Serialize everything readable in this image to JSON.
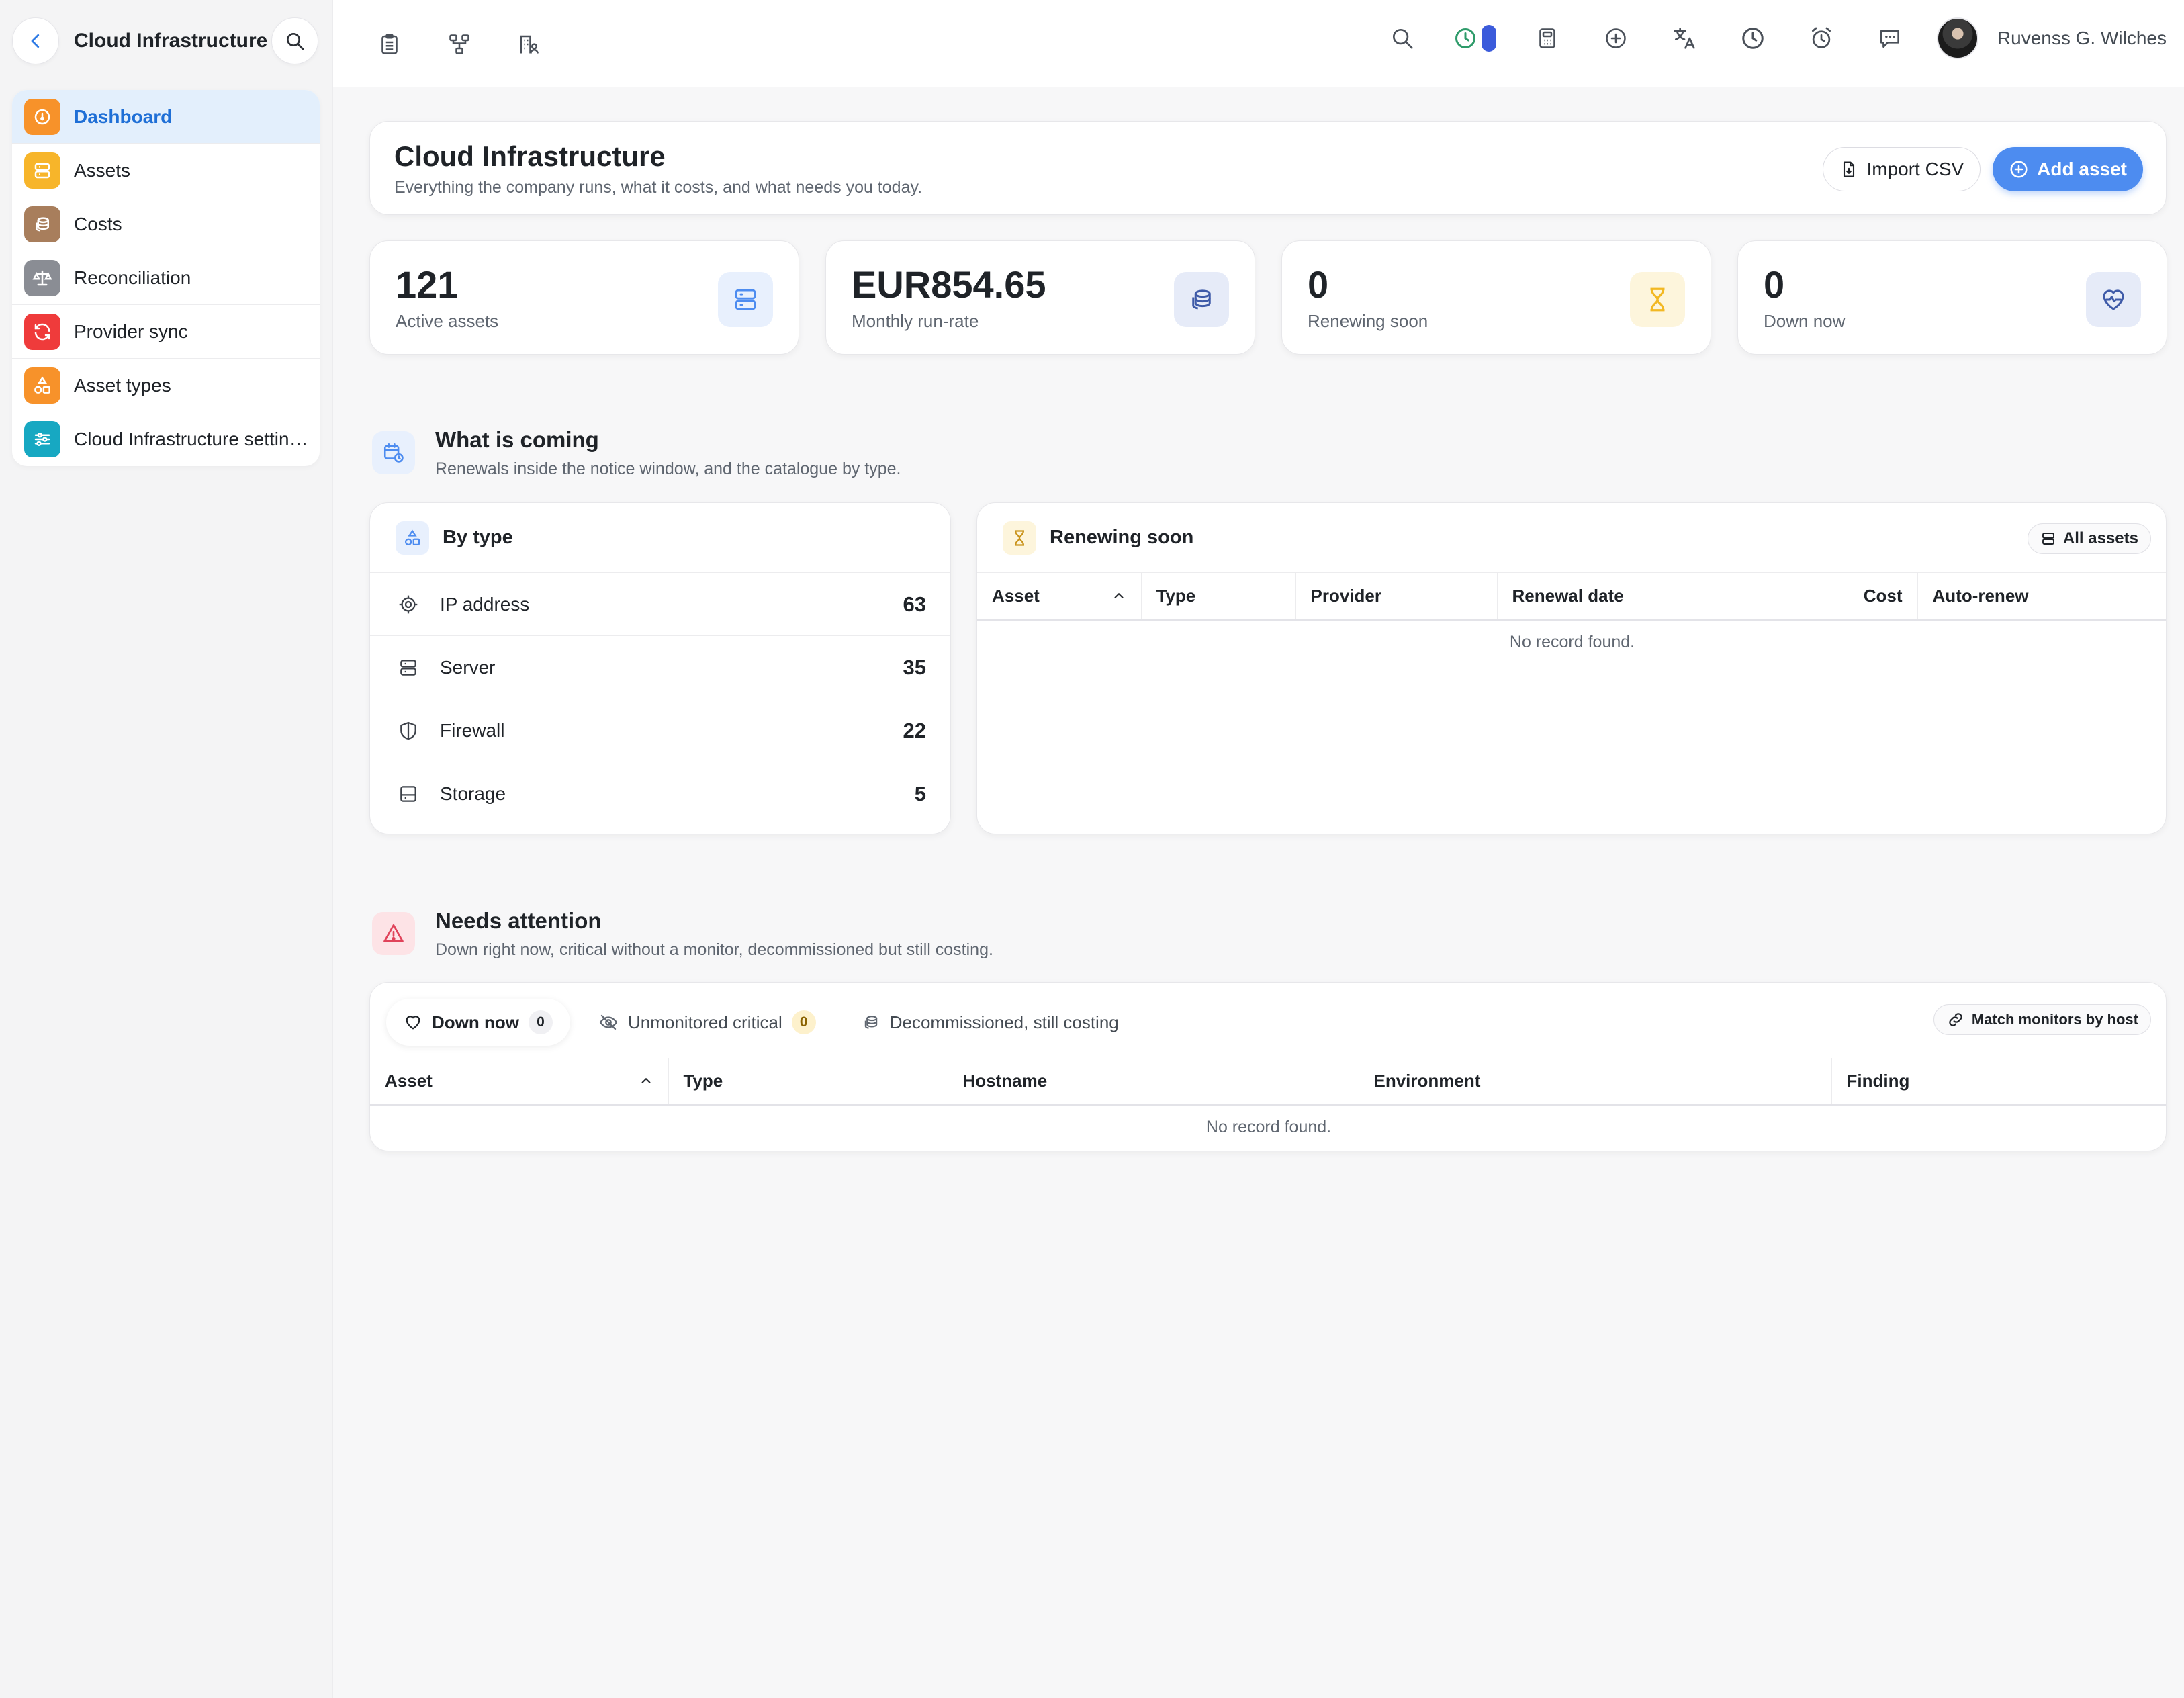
{
  "sidebar": {
    "title": "Cloud Infrastructure",
    "back_icon": "chevron-left-icon",
    "search_icon": "search-icon",
    "items": [
      {
        "label": "Dashboard",
        "icon": "dashboard-gauge-icon",
        "color": "#f7922a",
        "active": true
      },
      {
        "label": "Assets",
        "icon": "server-icon",
        "color": "#f7b52a"
      },
      {
        "label": "Costs",
        "icon": "coins-icon",
        "color": "#a87e5c"
      },
      {
        "label": "Reconciliation",
        "icon": "scale-icon",
        "color": "#8a8d94"
      },
      {
        "label": "Provider sync",
        "icon": "refresh-icon",
        "color": "#ef3b3b"
      },
      {
        "label": "Asset types",
        "icon": "shapes-icon",
        "color": "#f7922a"
      },
      {
        "label": "Cloud Infrastructure settings",
        "icon": "sliders-icon",
        "color": "#17a8c2"
      }
    ]
  },
  "topbar": {
    "left_icons": [
      "clipboard-icon",
      "hierarchy-icon",
      "building-users-icon"
    ],
    "right_icons": [
      "search-icon",
      "timer-icon",
      "calculator-icon",
      "plus-circle-icon",
      "translate-icon",
      "clock-icon",
      "alarm-icon",
      "chat-icon"
    ],
    "user_name": "Ruvenss G. Wilches"
  },
  "page": {
    "title": "Cloud Infrastructure",
    "subtitle": "Everything the company runs, what it costs, and what needs you today.",
    "import_label": "Import CSV",
    "add_label": "Add asset"
  },
  "stats": [
    {
      "value": "121",
      "label": "Active assets",
      "icon": "server-icon",
      "tint": "#e8f0fd",
      "color": "#4d8cf0"
    },
    {
      "value": "EUR854.65",
      "label": "Monthly run-rate",
      "icon": "coins-icon",
      "tint": "#e6ebf8",
      "color": "#3e5aa8"
    },
    {
      "value": "0",
      "label": "Renewing soon",
      "icon": "hourglass-icon",
      "tint": "#fdf5dc",
      "color": "#f2b823"
    },
    {
      "value": "0",
      "label": "Down now",
      "icon": "heart-pulse-icon",
      "tint": "#e6ebf8",
      "color": "#3e5aa8"
    }
  ],
  "coming": {
    "title": "What is coming",
    "subtitle": "Renewals inside the notice window, and the catalogue by type.",
    "by_type": {
      "title": "By type",
      "rows": [
        {
          "label": "IP address",
          "count": "63",
          "icon": "target-icon"
        },
        {
          "label": "Server",
          "count": "35",
          "icon": "server-icon"
        },
        {
          "label": "Firewall",
          "count": "22",
          "icon": "shield-icon"
        },
        {
          "label": "Storage",
          "count": "5",
          "icon": "storage-icon"
        }
      ]
    },
    "renewing": {
      "title": "Renewing soon",
      "all_label": "All assets",
      "columns": [
        "Asset",
        "Type",
        "Provider",
        "Renewal date",
        "Cost",
        "Auto-renew"
      ],
      "empty": "No record found."
    }
  },
  "attention": {
    "title": "Needs attention",
    "subtitle": "Down right now, critical without a monitor, decommissioned but still costing.",
    "tabs": [
      {
        "label": "Down now",
        "count": "0",
        "icon": "heart-icon",
        "active": true
      },
      {
        "label": "Unmonitored critical",
        "count": "0",
        "icon": "eye-off-icon"
      },
      {
        "label": "Decommissioned, still costing",
        "icon": "coins-icon"
      }
    ],
    "match_label": "Match monitors by host",
    "columns": [
      "Asset",
      "Type",
      "Hostname",
      "Environment",
      "Finding"
    ],
    "empty": "No record found."
  }
}
